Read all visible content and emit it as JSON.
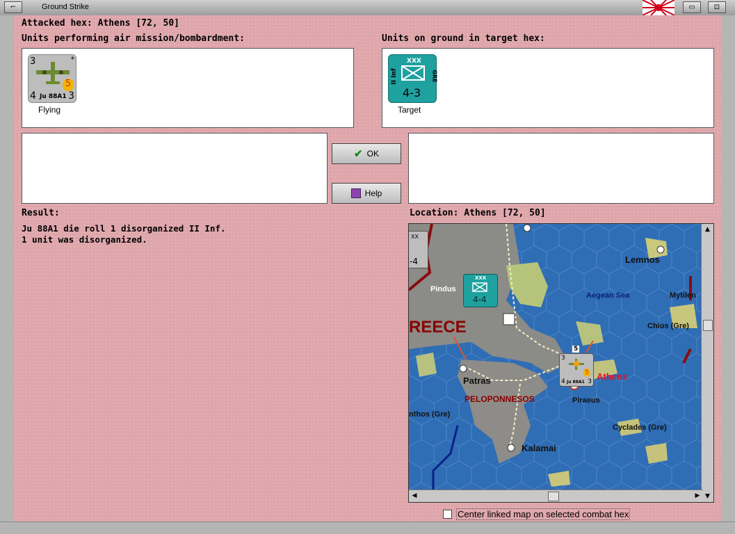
{
  "window": {
    "title": "Ground Strike"
  },
  "attacked_hex": "Attacked hex: Athens  [72, 50]",
  "air_units": {
    "header": "Units performing air mission/bombardment:",
    "unit": {
      "attack": "3",
      "defense": "4",
      "move": "3",
      "range": "5",
      "name": "Ju 88A1",
      "marker": "*",
      "status": "Flying"
    }
  },
  "ground_units": {
    "header": "Units on ground in target hex:",
    "unit": {
      "size": "XXX",
      "type": "II Inf",
      "nation": "GRE",
      "strength": "4-3",
      "status": "Target"
    }
  },
  "buttons": {
    "ok": "OK",
    "help": "Help"
  },
  "result": {
    "header": "Result:",
    "lines": [
      "Ju 88A1 die roll 1 disorganized II Inf.",
      "1 unit was disorganized."
    ]
  },
  "location": "Location:  Athens  [72, 50]",
  "map": {
    "labels": {
      "lemnos": "Lemnos",
      "aegean": "Aegean Sea",
      "mytilene": "Mytilen",
      "pindus": "Pindus",
      "greece": "REECE",
      "chios": "Chios (Gre)",
      "patras": "Patras",
      "athens": "Athens",
      "peloponnesos": "PELOPONNESOS",
      "piraeus": "Piraeus",
      "zakynthos": "nthos (Gre)",
      "cyclades": "Cyclades (Gre)",
      "kalamai": "Kalamai"
    },
    "counter_left": {
      "size": "XX",
      "strength": "-4"
    },
    "counter_pindus": {
      "size": "XXX",
      "strength": "4-4"
    },
    "counter_athens": {
      "top": "5",
      "attack": "3",
      "defense": "4",
      "range": "5",
      "move": "3",
      "name": "Ju 88A1"
    }
  },
  "checkbox": {
    "label": "Center linked map on selected combat hex",
    "checked": false
  },
  "colors": {
    "background": "#dea6ab",
    "unit_green": "#1fa1a0",
    "accent_red": "#8b0000"
  }
}
